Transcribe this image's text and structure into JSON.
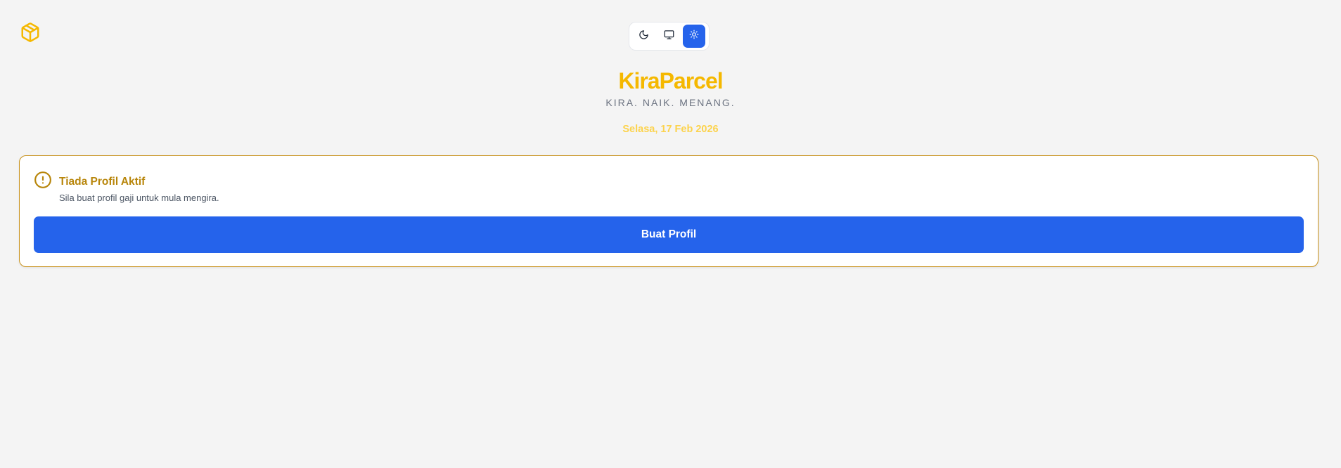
{
  "app": {
    "logo_icon": "package-box-icon",
    "brand": "KiraParcel",
    "tagline": "KIRA. NAIK. MENANG.",
    "date": "Selasa, 17 Feb 2026"
  },
  "theme_switcher": {
    "options": [
      {
        "name": "dark",
        "icon": "moon-icon",
        "active": false
      },
      {
        "name": "system",
        "icon": "monitor-icon",
        "active": false
      },
      {
        "name": "light",
        "icon": "sun-icon",
        "active": true
      }
    ]
  },
  "notice": {
    "icon": "alert-circle-icon",
    "title": "Tiada Profil Aktif",
    "description": "Sila buat profil gaji untuk mula mengira.",
    "button_label": "Buat Profil"
  },
  "colors": {
    "brand": "#f5b800",
    "accent": "#2563eb",
    "warning_border": "#c8921c",
    "warning_text": "#b8860b",
    "date": "#fcd34d",
    "background": "#f4f4f4"
  }
}
